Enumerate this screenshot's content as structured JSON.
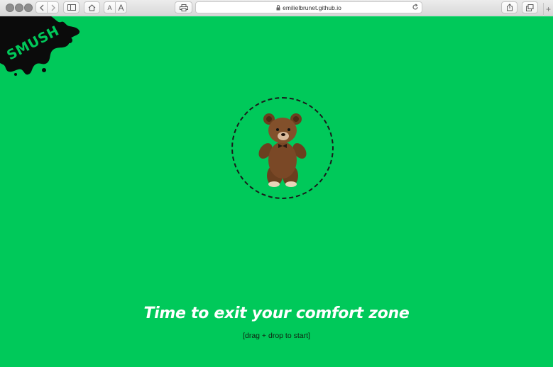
{
  "browser": {
    "url": "emilielbrunet.github.io",
    "font_small_label": "A",
    "font_large_label": "A",
    "new_tab_label": "+"
  },
  "page": {
    "background": "#00c95a",
    "logo_text": "SMUSH",
    "headline": "Time to exit your comfort zone",
    "hint": "[drag + drop to start]"
  }
}
